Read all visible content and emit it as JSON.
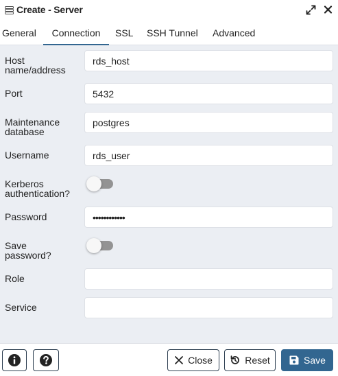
{
  "dialog": {
    "title": "Create - Server",
    "icon": "server-icon"
  },
  "tabs": [
    {
      "label": "General",
      "active": false
    },
    {
      "label": "Connection",
      "active": true
    },
    {
      "label": "SSL",
      "active": false
    },
    {
      "label": "SSH Tunnel",
      "active": false
    },
    {
      "label": "Advanced",
      "active": false
    }
  ],
  "form": {
    "host": {
      "label_line1": "Host",
      "label_line2": "name/address",
      "value": "rds_host"
    },
    "port": {
      "label": "Port",
      "value": "5432"
    },
    "maintenance_db": {
      "label_line1": "Maintenance",
      "label_line2": "database",
      "value": "postgres"
    },
    "username": {
      "label": "Username",
      "value": "rds_user"
    },
    "kerberos": {
      "label_line1": "Kerberos",
      "label_line2": "authentication?",
      "enabled": false
    },
    "password": {
      "label": "Password",
      "value": "••••••••••••"
    },
    "save_password": {
      "label_line1": "Save",
      "label_line2": "password?",
      "enabled": false
    },
    "role": {
      "label": "Role",
      "value": ""
    },
    "service": {
      "label": "Service",
      "value": ""
    }
  },
  "footer": {
    "info_icon": "info-icon",
    "help_icon": "help-icon",
    "close_label": "Close",
    "reset_label": "Reset",
    "save_label": "Save"
  },
  "colors": {
    "accent": "#326690",
    "form_background": "#ebeef3",
    "toggle_track": "#939393"
  }
}
